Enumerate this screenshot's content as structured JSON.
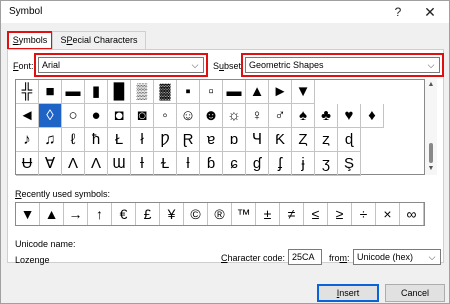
{
  "window": {
    "title": "Symbol",
    "help": "?",
    "close": "✕"
  },
  "tabs": [
    {
      "label": "Symbols",
      "mnemonic": "S",
      "rest": "ymbols",
      "active": true
    },
    {
      "label": "Special Characters",
      "mnemonic": "P",
      "rest": "ecial Characters",
      "prefix": "S"
    }
  ],
  "font": {
    "label_pre": "",
    "label_mn": "F",
    "label_rest": "ont:",
    "value": "Arial"
  },
  "subset": {
    "label_mn": "u",
    "label_pre": "S",
    "label_rest": "bset:",
    "value": "Geometric Shapes"
  },
  "symbols_grid": [
    [
      "╬",
      "■",
      "▬",
      "▮",
      "█",
      "▒",
      "▓",
      "▪",
      "▫",
      "▬",
      "▲",
      "►",
      "▼"
    ],
    [
      "◄",
      "◊",
      "○",
      "●",
      "◘",
      "◙",
      "◦",
      "☺",
      "☻",
      "☼",
      "♀",
      "♂",
      "♠",
      "♣",
      "♥",
      "♦"
    ],
    [
      "♪",
      "♫",
      "ℓ",
      "ħ",
      "Ł",
      "ł",
      "Ƿ",
      "Ɽ",
      "ɐ",
      "ɒ",
      "Ɥ",
      "Ƙ",
      "Ȥ",
      "ȥ",
      "ɖ"
    ],
    [
      "Ʉ",
      "Ɐ",
      "Ʌ",
      "Ʌ",
      "Ɯ",
      "Ɨ",
      "Ɫ",
      "ƚ",
      "ɓ",
      "ɕ",
      "ɠ",
      "ʄ",
      "ɉ",
      "ʒ",
      "Ş"
    ]
  ],
  "selected_symbol": "◊",
  "recently_used": {
    "label_mn": "R",
    "label_rest": "ecently used symbols:",
    "symbols": [
      "▼",
      "▲",
      "→",
      "↑",
      "€",
      "£",
      "¥",
      "©",
      "®",
      "™",
      "±",
      "≠",
      "≤",
      "≥",
      "÷",
      "×",
      "∞"
    ]
  },
  "unicode_name": {
    "label": "Unicode name:",
    "value": "Lozenge"
  },
  "character_code": {
    "label_mn": "C",
    "label_rest": "haracter code:",
    "value": "25CA"
  },
  "from": {
    "label_mn": "m",
    "label_pre": "fro",
    "label_rest": ":",
    "value": "Unicode (hex)"
  },
  "buttons": {
    "insert": "Insert",
    "insert_mn": "I",
    "insert_rest": "nsert",
    "cancel": "Cancel"
  }
}
